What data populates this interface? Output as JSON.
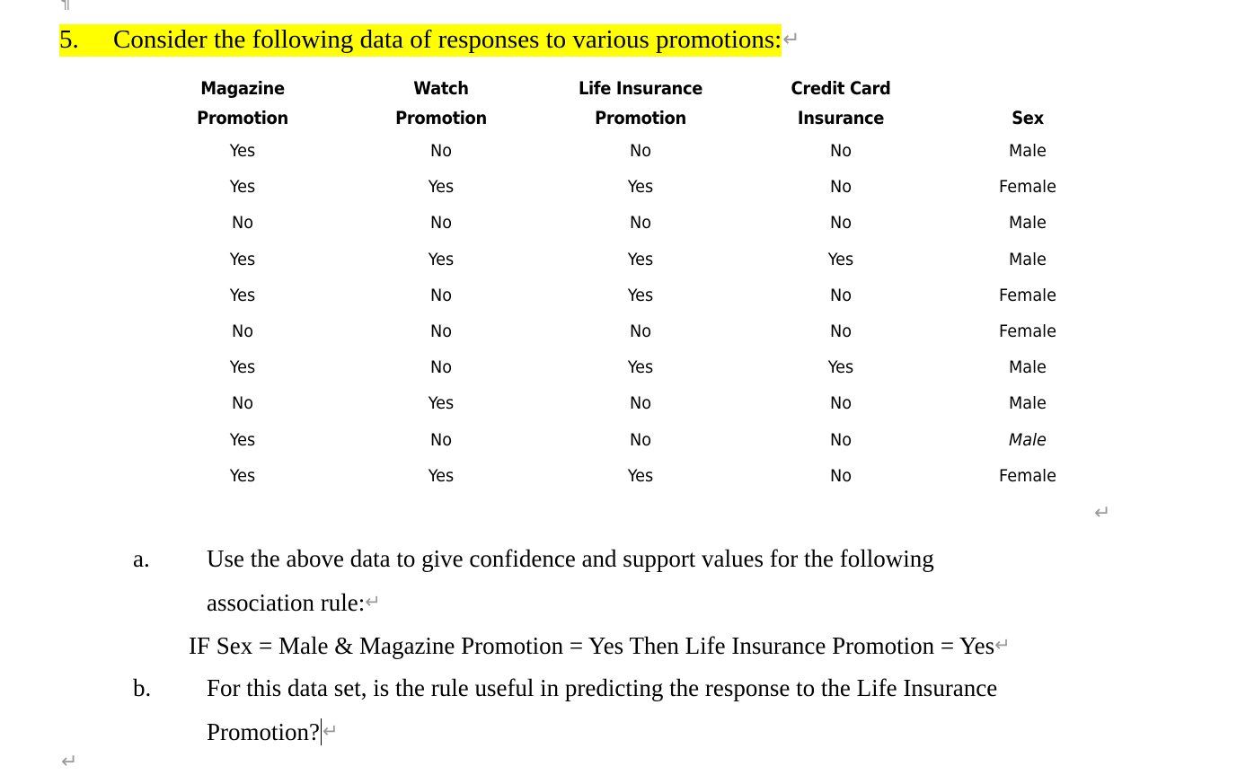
{
  "document": {
    "top_paragraph_mark": "¶",
    "bottom_paragraph_mark": "↵",
    "return_mark": "↵",
    "highlight_color": "#ffff00"
  },
  "question": {
    "number": "5.",
    "text": "Consider the following data of responses to various promotions:",
    "return_mark": "↵"
  },
  "table": {
    "headers": [
      {
        "line1": "Magazine",
        "line2": "Promotion"
      },
      {
        "line1": "Watch",
        "line2": "Promotion"
      },
      {
        "line1": "Life Insurance",
        "line2": "Promotion"
      },
      {
        "line1": "Credit Card",
        "line2": "Insurance"
      },
      {
        "line1": "",
        "line2": "Sex"
      }
    ],
    "rows": [
      [
        "Yes",
        "No",
        "No",
        "No",
        "Male"
      ],
      [
        "Yes",
        "Yes",
        "Yes",
        "No",
        "Female"
      ],
      [
        "No",
        "No",
        "No",
        "No",
        "Male"
      ],
      [
        "Yes",
        "Yes",
        "Yes",
        "Yes",
        "Male"
      ],
      [
        "Yes",
        "No",
        "Yes",
        "No",
        "Female"
      ],
      [
        "No",
        "No",
        "No",
        "No",
        "Female"
      ],
      [
        "Yes",
        "No",
        "Yes",
        "Yes",
        "Male"
      ],
      [
        "No",
        "Yes",
        "No",
        "No",
        "Male"
      ],
      [
        "Yes",
        "No",
        "No",
        "No",
        "Male"
      ],
      [
        "Yes",
        "Yes",
        "Yes",
        "No",
        "Female"
      ]
    ],
    "trailing_return_mark": "↵"
  },
  "items": {
    "a": {
      "letter": "a.",
      "line1": "Use the above data to give confidence and support values for the following",
      "line2": "association rule:",
      "return_mark": "↵"
    },
    "rule": {
      "text": "IF Sex = Male & Magazine Promotion = Yes Then Life Insurance Promotion = Yes",
      "return_mark": "↵"
    },
    "b": {
      "letter": "b.",
      "line1": "For this data set, is the rule useful in predicting the response to the Life Insurance",
      "line2": "Promotion?",
      "return_mark": "↵"
    }
  }
}
